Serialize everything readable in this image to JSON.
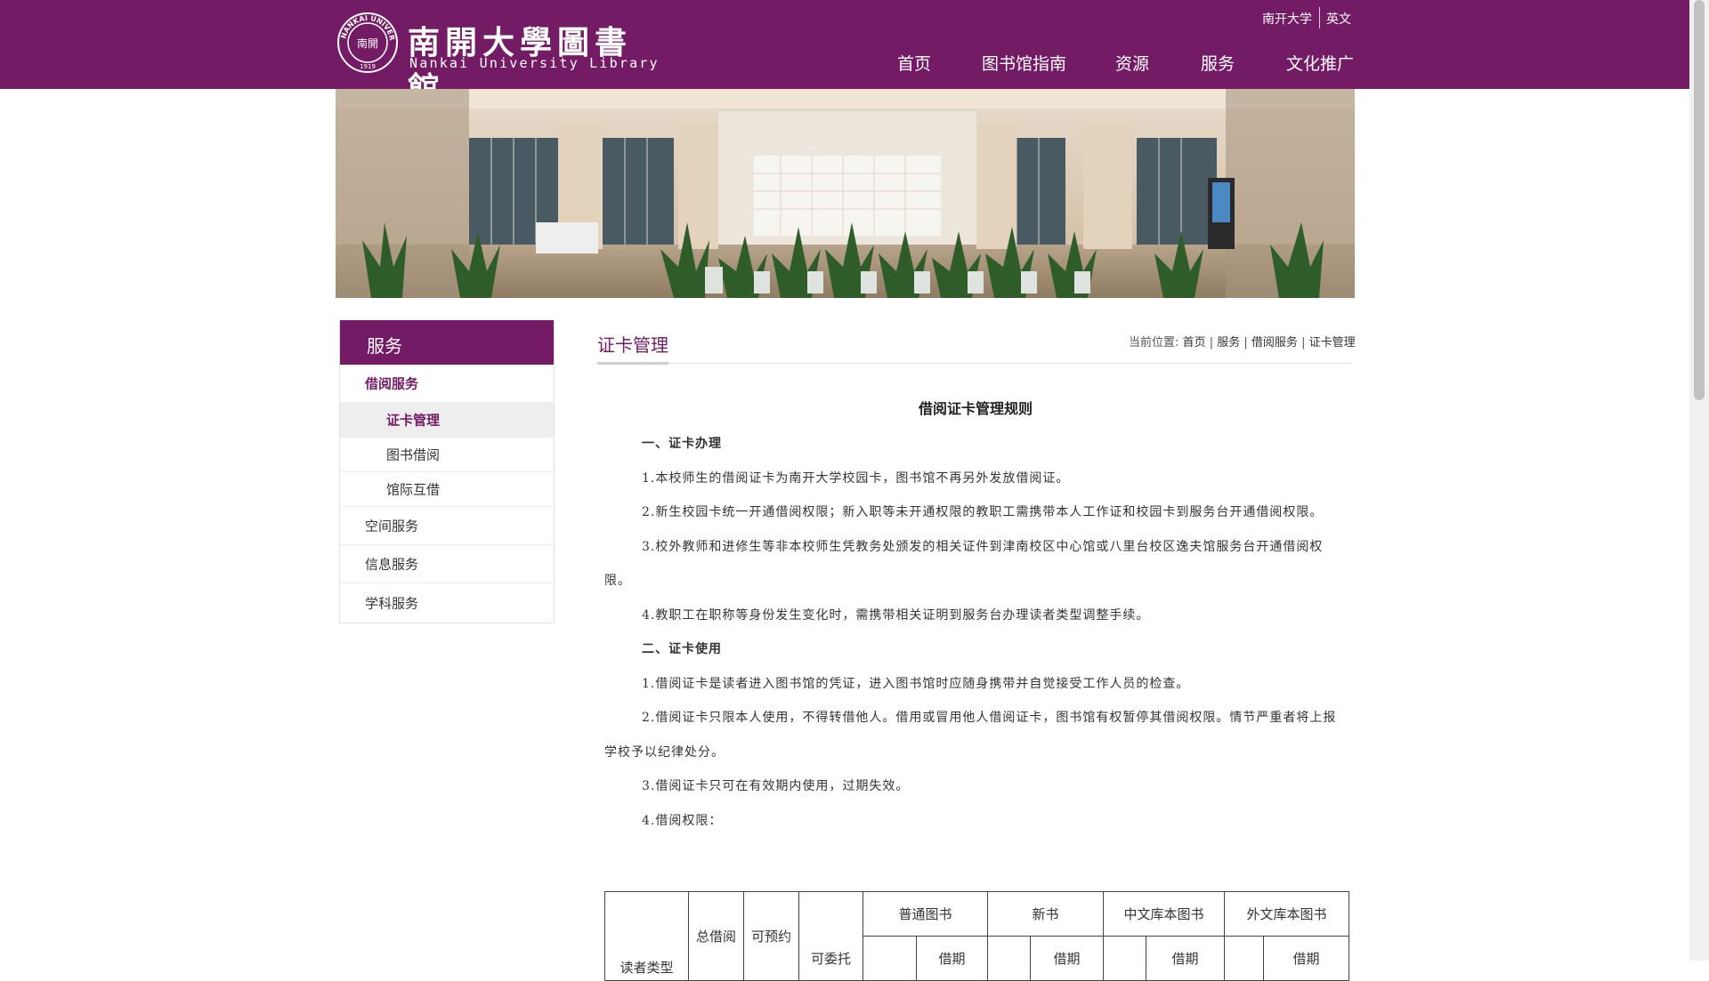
{
  "header": {
    "logo_cn": "南開大學圖書館",
    "logo_en": "Nankai University Library",
    "seal_text": "NANKAI UNIVERSITY",
    "seal_year": "1919",
    "seal_center": "南開",
    "top_links": [
      "南开大学",
      "英文"
    ],
    "nav": [
      "首页",
      "图书馆指南",
      "资源",
      "服务",
      "文化推广"
    ]
  },
  "sidebar": {
    "title": "服务",
    "items": [
      {
        "label": "借阅服务",
        "active": true
      },
      {
        "label": "证卡管理",
        "selected": true
      },
      {
        "label": "图书借阅"
      },
      {
        "label": "馆际互借"
      },
      {
        "label": "空间服务"
      },
      {
        "label": "信息服务"
      },
      {
        "label": "学科服务"
      }
    ]
  },
  "main": {
    "title": "证卡管理",
    "breadcrumb": {
      "prefix": "当前位置:",
      "links": [
        "首页",
        "服务",
        "借阅服务",
        "证卡管理"
      ],
      "separator": "|"
    },
    "article_title": "借阅证卡管理规则",
    "paragraphs": [
      "一、证卡办理",
      "1.本校师生的借阅证卡为南开大学校园卡，图书馆不再另外发放借阅证。",
      "2.新生校园卡统一开通借阅权限；新入职等未开通权限的教职工需携带本人工作证和校园卡到服务台开通借阅权限。",
      "3.校外教师和进修生等非本校师生凭教务处颁发的相关证件到津南校区中心馆或八里台校区逸夫馆服务台开通借阅权限。",
      "4.教职工在职称等身份发生变化时，需携带相关证明到服务台办理读者类型调整手续。",
      "二、证卡使用",
      "1.借阅证卡是读者进入图书馆的凭证，进入图书馆时应随身携带并自觉接受工作人员的检查。",
      "2.借阅证卡只限本人使用，不得转借他人。借用或冒用他人借阅证卡，图书馆有权暂停其借阅权限。情节严重者将上报学校予以纪律处分。",
      "3.借阅证卡只可在有效期内使用，过期失效。",
      "4.借阅权限："
    ],
    "table": {
      "col_reader": "读者类型",
      "col_total": "总借阅",
      "col_reserve": "可预约",
      "col_entrust": "可委托",
      "groups": [
        "普通图书",
        "新书",
        "中文库本图书",
        "外文库本图书"
      ],
      "sub": "借期"
    }
  },
  "colors": {
    "brand": "#731b65",
    "text": "#333333"
  }
}
